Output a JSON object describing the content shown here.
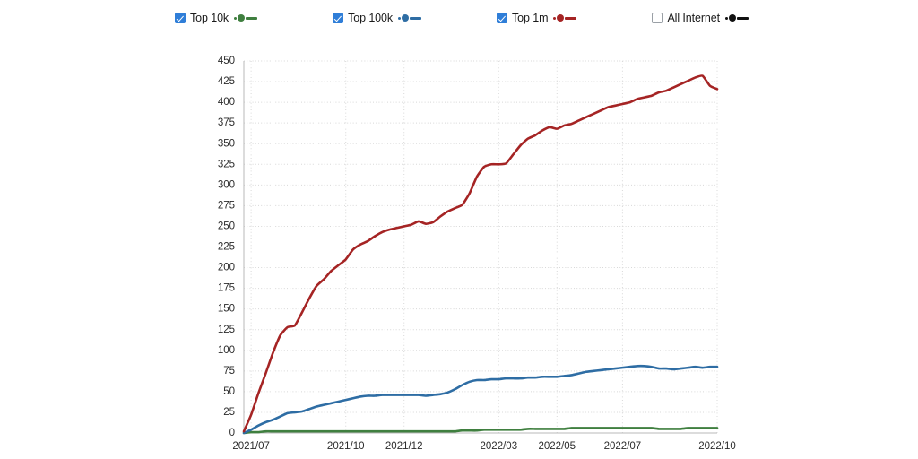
{
  "legend": {
    "items": [
      {
        "label": "Top 10k",
        "color": "#3f7f3f",
        "checked": true,
        "icon": "checkbox-checked-icon"
      },
      {
        "label": "Top 100k",
        "color": "#2e6da4",
        "checked": true,
        "icon": "checkbox-checked-icon"
      },
      {
        "label": "Top 1m",
        "color": "#a52424",
        "checked": true,
        "icon": "checkbox-checked-icon"
      },
      {
        "label": "All Internet",
        "color": "#111111",
        "checked": false,
        "icon": "checkbox-unchecked-icon"
      }
    ]
  },
  "chart_data": {
    "type": "line",
    "title": "",
    "subtitle": "",
    "xlabel": "",
    "ylabel": "",
    "grid": true,
    "legend_position": "top",
    "ylim": [
      0,
      450
    ],
    "ytick_step": 25,
    "ytick_labels": [
      "0",
      "25",
      "50",
      "75",
      "100",
      "125",
      "150",
      "175",
      "200",
      "225",
      "250",
      "275",
      "300",
      "325",
      "350",
      "375",
      "400",
      "425",
      "450"
    ],
    "xtick_labels": [
      "2021/07",
      "2021/10",
      "2021/12",
      "2022/03",
      "2022/05",
      "2022/07",
      "2022/10"
    ],
    "x_index_of_ticks": [
      1,
      14,
      22,
      35,
      43,
      52,
      65
    ],
    "x": [
      "2021/06",
      "2021/07",
      "2021/07",
      "2021/07",
      "2021/07",
      "2021/08",
      "2021/08",
      "2021/08",
      "2021/08",
      "2021/09",
      "2021/09",
      "2021/09",
      "2021/09",
      "2021/10",
      "2021/10",
      "2021/10",
      "2021/10",
      "2021/11",
      "2021/11",
      "2021/11",
      "2021/11",
      "2021/12",
      "2021/12",
      "2021/12",
      "2021/12",
      "2022/01",
      "2022/01",
      "2022/01",
      "2022/01",
      "2022/02",
      "2022/02",
      "2022/02",
      "2022/02",
      "2022/03",
      "2022/03",
      "2022/03",
      "2022/03",
      "2022/04",
      "2022/04",
      "2022/04",
      "2022/04",
      "2022/05",
      "2022/05",
      "2022/05",
      "2022/05",
      "2022/06",
      "2022/06",
      "2022/06",
      "2022/06",
      "2022/07",
      "2022/07",
      "2022/07",
      "2022/07",
      "2022/08",
      "2022/08",
      "2022/08",
      "2022/08",
      "2022/09",
      "2022/09",
      "2022/09",
      "2022/09",
      "2022/10",
      "2022/10",
      "2022/10",
      "2022/10",
      "2022/10"
    ],
    "series": [
      {
        "name": "Top 1m",
        "color": "#a52424",
        "values": [
          2,
          22,
          48,
          72,
          97,
          118,
          128,
          130,
          146,
          163,
          178,
          186,
          196,
          203,
          210,
          222,
          228,
          232,
          238,
          243,
          246,
          248,
          250,
          252,
          256,
          253,
          255,
          262,
          268,
          272,
          276,
          290,
          310,
          322,
          325,
          325,
          326,
          337,
          348,
          356,
          360,
          366,
          370,
          368,
          372,
          374,
          378,
          382,
          386,
          390,
          394,
          396,
          398,
          400,
          404,
          406,
          408,
          412,
          414,
          418,
          422,
          426,
          430,
          432,
          420,
          416
        ]
      },
      {
        "name": "Top 100k",
        "color": "#2e6da4",
        "values": [
          0,
          4,
          9,
          13,
          16,
          20,
          24,
          25,
          26,
          29,
          32,
          34,
          36,
          38,
          40,
          42,
          44,
          45,
          45,
          46,
          46,
          46,
          46,
          46,
          46,
          45,
          46,
          47,
          49,
          53,
          58,
          62,
          64,
          64,
          65,
          65,
          66,
          66,
          66,
          67,
          67,
          68,
          68,
          68,
          69,
          70,
          72,
          74,
          75,
          76,
          77,
          78,
          79,
          80,
          81,
          81,
          80,
          78,
          78,
          77,
          78,
          79,
          80,
          79,
          80,
          80
        ]
      },
      {
        "name": "Top 10k",
        "color": "#3f7f3f",
        "values": [
          0,
          1,
          1,
          2,
          2,
          2,
          2,
          2,
          2,
          2,
          2,
          2,
          2,
          2,
          2,
          2,
          2,
          2,
          2,
          2,
          2,
          2,
          2,
          2,
          2,
          2,
          2,
          2,
          2,
          2,
          3,
          3,
          3,
          4,
          4,
          4,
          4,
          4,
          4,
          5,
          5,
          5,
          5,
          5,
          5,
          6,
          6,
          6,
          6,
          6,
          6,
          6,
          6,
          6,
          6,
          6,
          6,
          5,
          5,
          5,
          5,
          6,
          6,
          6,
          6,
          6
        ]
      }
    ]
  }
}
